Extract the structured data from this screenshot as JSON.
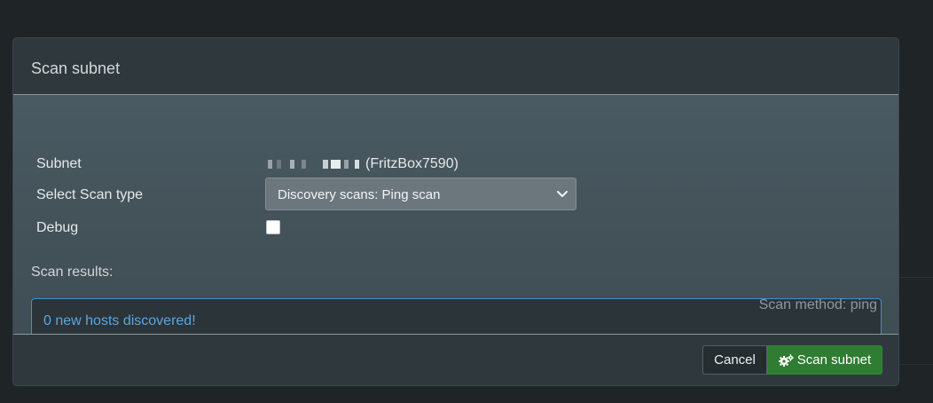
{
  "modal": {
    "title": "Scan subnet",
    "form": {
      "subnet_label": "Subnet",
      "subnet_value_suffix": "(FritzBox7590)",
      "scan_type_label": "Select Scan type",
      "scan_type_selected": "Discovery scans: Ping scan",
      "debug_label": "Debug",
      "debug_checked": false
    },
    "results": {
      "label": "Scan results:",
      "message": "0 new hosts discovered!",
      "method_text": "Scan method: ping"
    },
    "footer": {
      "cancel_label": "Cancel",
      "scan_label": "Scan subnet",
      "scan_icon": "gears-icon"
    }
  },
  "colors": {
    "accent_green": "#2e7d32",
    "info_blue": "#5aa6e4",
    "panel_bg": "#2f383d"
  }
}
